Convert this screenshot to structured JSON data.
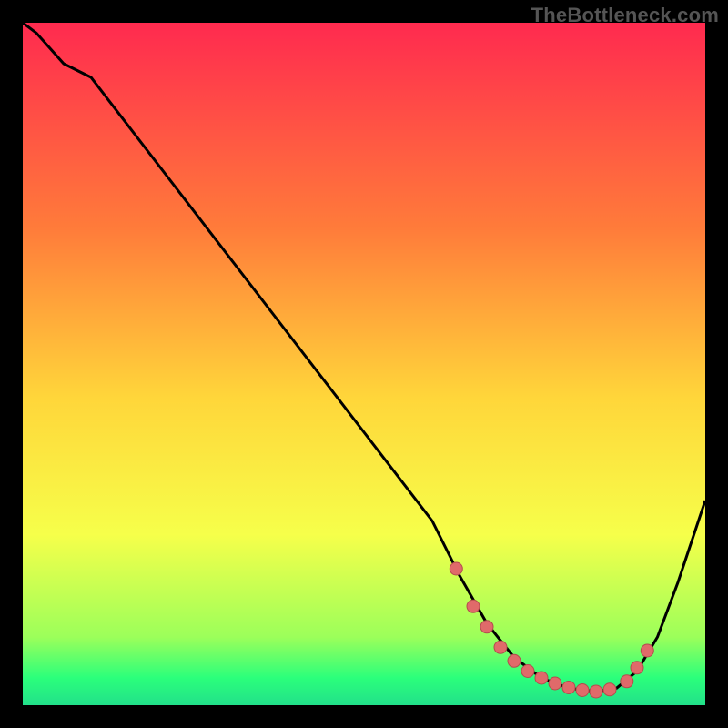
{
  "watermark": "TheBottleneck.com",
  "colors": {
    "page_bg": "#000000",
    "grad_top": "#ff2a4f",
    "grad_upper_mid": "#ff7b3a",
    "grad_mid": "#ffd63a",
    "grad_lower_mid": "#f6ff4a",
    "grad_green1": "#9cff5a",
    "grad_green2": "#2bff7b",
    "grad_green3": "#22e08a",
    "curve": "#000000",
    "marker_fill": "#e06a6a",
    "marker_stroke": "#b24d4d"
  },
  "chart_data": {
    "type": "line",
    "title": "",
    "xlabel": "",
    "ylabel": "",
    "xlim": [
      0,
      100
    ],
    "ylim": [
      0,
      100
    ],
    "series": [
      {
        "name": "curve",
        "x": [
          0,
          2,
          6,
          10,
          20,
          30,
          40,
          50,
          60,
          64,
          68,
          72,
          76,
          80,
          84,
          87,
          90,
          93,
          96,
          100
        ],
        "y": [
          100,
          98.5,
          94,
          92,
          79,
          66,
          53,
          40,
          27,
          19,
          12,
          7,
          4,
          2.5,
          2,
          2.5,
          5,
          10,
          18,
          30
        ]
      }
    ],
    "markers": {
      "x": [
        63.5,
        66,
        68,
        70,
        72,
        74,
        76,
        78,
        80,
        82,
        84,
        86,
        88.5,
        90,
        91.5
      ],
      "y": [
        20,
        14.5,
        11.5,
        8.5,
        6.5,
        5,
        4,
        3.2,
        2.6,
        2.2,
        2,
        2.3,
        3.5,
        5.5,
        8
      ]
    }
  }
}
